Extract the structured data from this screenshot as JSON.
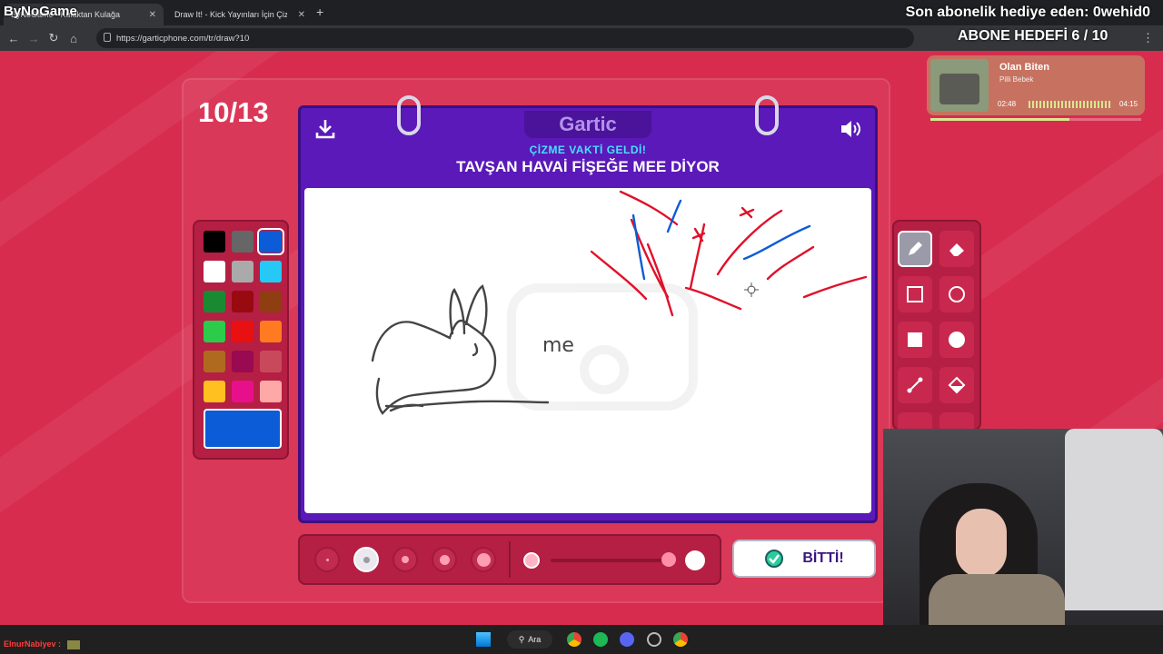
{
  "browser": {
    "tabs": [
      {
        "label": "ByNoGame - Kulaktan Kulağa"
      },
      {
        "label": "Draw It! - Kick Yayınları İçin Çizi"
      }
    ],
    "url": "https://garticphone.com/tr/draw?10"
  },
  "overlay": {
    "brand": "ByNoGame",
    "sub_alert": "Son abonelik hediye eden: 0wehid0",
    "goal": "ABONE HEDEFİ 6 / 10",
    "music": {
      "title": "Olan Biten",
      "artist": "Pilli Bebek",
      "elapsed": "02:48",
      "total": "04:15",
      "progress": 0.66
    },
    "chat": "ElnurNabiyev :"
  },
  "game": {
    "round": "10/13",
    "logo": "Gartic",
    "subtitle": "ÇİZME VAKTİ GELDİ!",
    "prompt": "TAVŞAN HAVAİ FİŞEĞE MEE DİYOR",
    "canvas_text": "me",
    "palette": [
      "#000000",
      "#666666",
      "#0b5cd6",
      "#ffffff",
      "#aaaaaa",
      "#26c8f5",
      "#1a8a32",
      "#990a10",
      "#8e3e10",
      "#2ccb4a",
      "#e81010",
      "#ff7a20",
      "#b06a20",
      "#9a0a50",
      "#c84a5a",
      "#ffc020",
      "#e8108a",
      "#ffa8a8"
    ],
    "selected_color": "#0b5cd6",
    "done_label": "BİTTİ!"
  },
  "taskbar": {
    "search": "Ara"
  }
}
